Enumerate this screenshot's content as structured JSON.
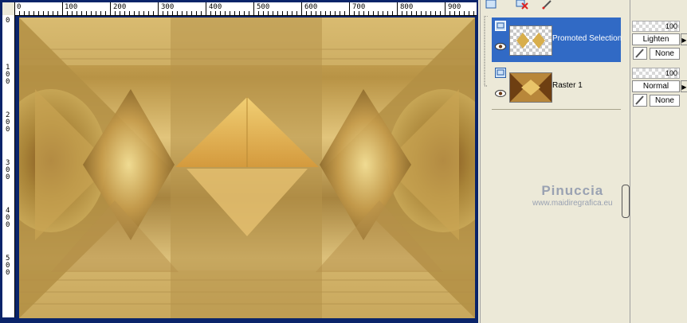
{
  "ruler": {
    "top_labels": [
      "0",
      "100",
      "200",
      "300",
      "400",
      "500",
      "600",
      "700",
      "800",
      "900"
    ],
    "left_labels": [
      "0",
      "1\n0\n0",
      "2\n0\n0",
      "3\n0\n0",
      "4\n0\n0",
      "5\n0\n0"
    ]
  },
  "layers": [
    {
      "name": "Promoted Selection",
      "selected": true
    },
    {
      "name": "Raster 1",
      "selected": false
    }
  ],
  "properties": [
    {
      "opacity": "100",
      "blend_mode": "Lighten",
      "mask": "None"
    },
    {
      "opacity": "100",
      "blend_mode": "Normal",
      "mask": "None"
    }
  ],
  "watermark": {
    "name": "Pinuccia",
    "url": "www.maidiregrafica.eu"
  },
  "colors": {
    "selection": "#316ac5",
    "canvas_frame": "#0a246a",
    "panel_bg": "#ece9d8"
  }
}
